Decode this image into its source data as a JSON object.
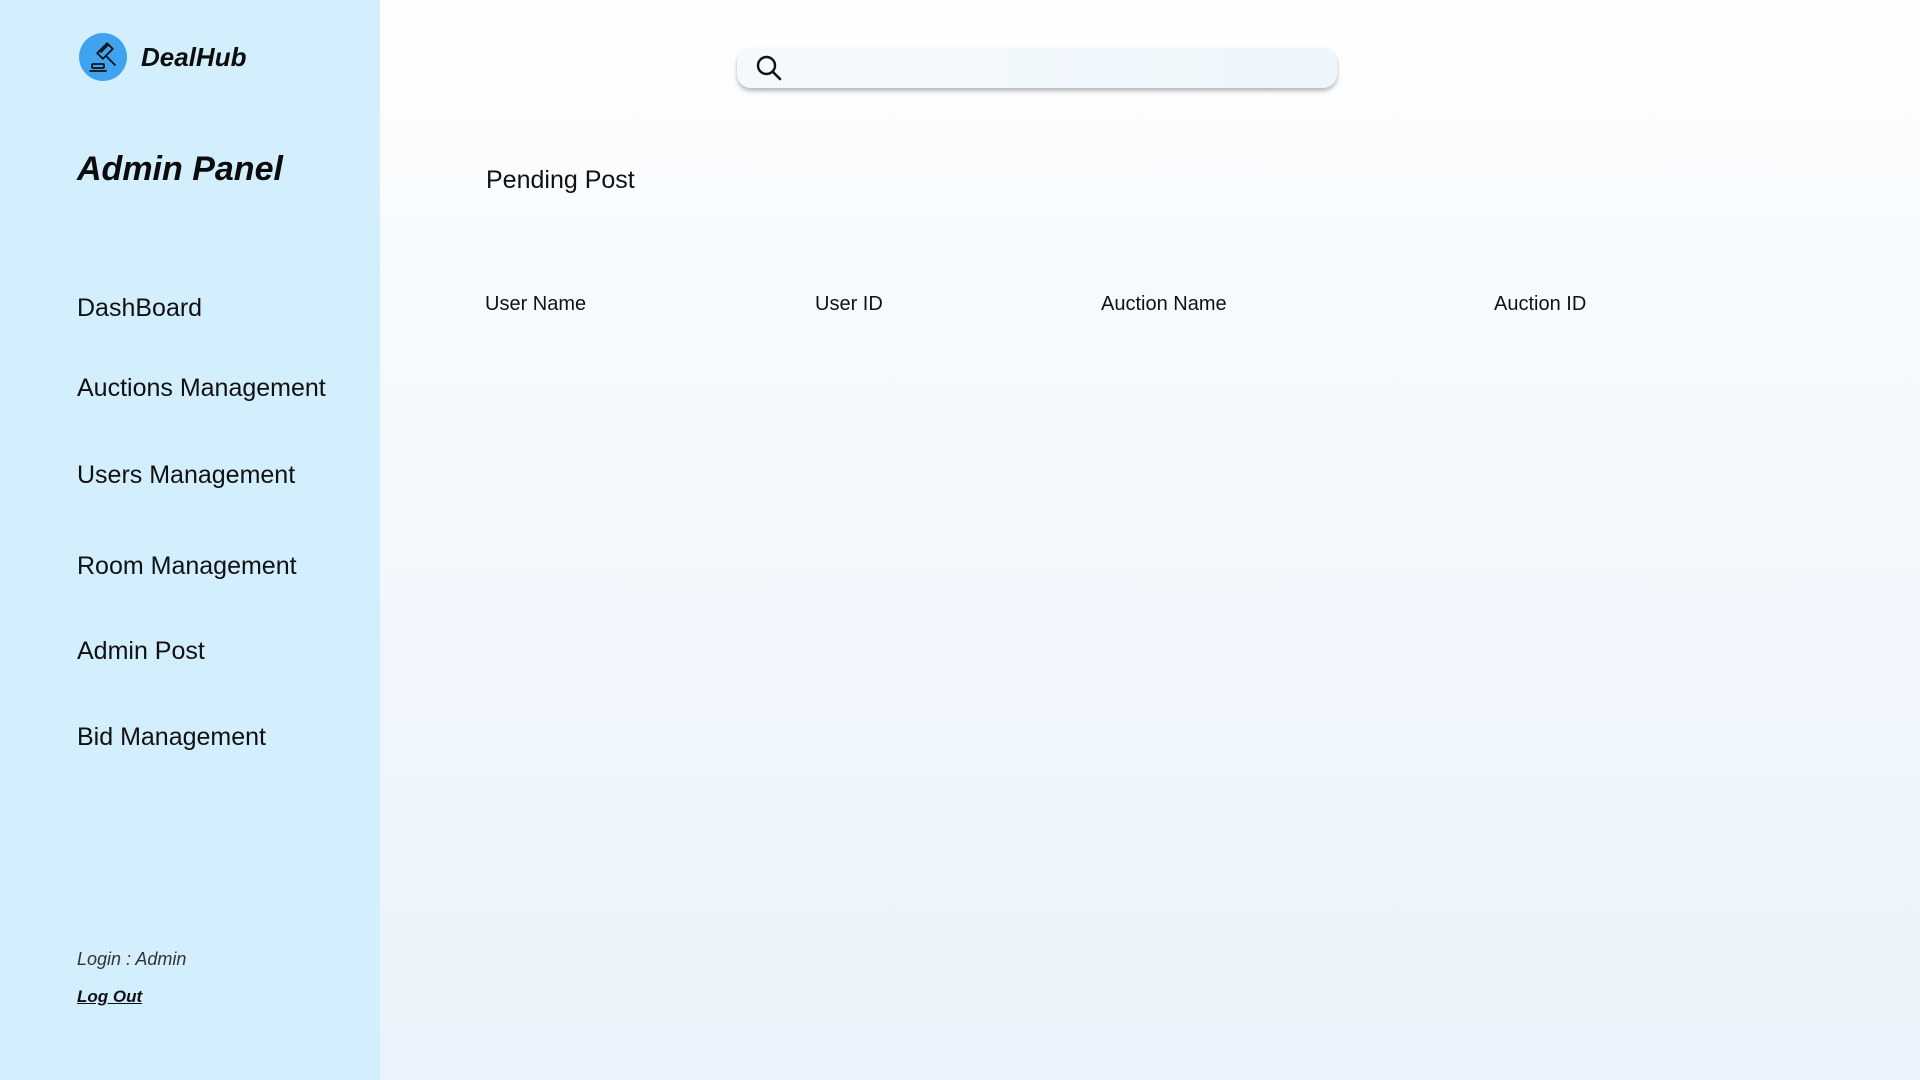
{
  "brand": {
    "name": "DealHub",
    "logo_icon": "gavel-icon",
    "logo_color": "#3fa3f0"
  },
  "sidebar": {
    "title": "Admin Panel",
    "background": "#d3effd",
    "items": [
      {
        "label": "DashBoard"
      },
      {
        "label": "Auctions Management"
      },
      {
        "label": "Users Management"
      },
      {
        "label": "Room Management"
      },
      {
        "label": "Admin Post"
      },
      {
        "label": "Bid Management"
      }
    ],
    "login_info": "Login : Admin",
    "logout_label": "Log Out"
  },
  "search": {
    "placeholder": "",
    "value": "",
    "icon": "search-icon"
  },
  "main": {
    "title": "Pending Post",
    "table": {
      "columns": [
        "User Name",
        "User ID",
        "Auction Name",
        "Auction ID"
      ],
      "rows": []
    }
  }
}
